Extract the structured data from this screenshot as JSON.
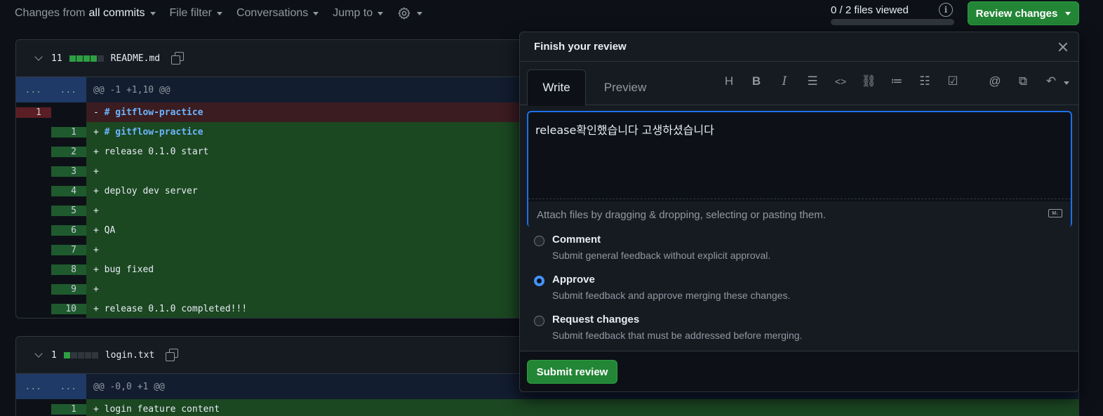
{
  "toolbar": {
    "changes_prefix": "Changes from",
    "changes_value": "all commits",
    "file_filter": "File filter",
    "conversations": "Conversations",
    "jump_to": "Jump to"
  },
  "progress": {
    "files_viewed": "0 / 2 files viewed",
    "fraction": 0
  },
  "review_button": "Review changes",
  "files": [
    {
      "count": "11",
      "name": "README.md",
      "hunk": "@@ -1 +1,10 @@",
      "dots": "...",
      "rows": [
        {
          "old": "1",
          "new": "",
          "sign": "-",
          "text": "# gitflow-practice"
        },
        {
          "old": "",
          "new": "1",
          "sign": "+",
          "text": "# gitflow-practice"
        },
        {
          "old": "",
          "new": "2",
          "sign": "+",
          "text": "release 0.1.0 start"
        },
        {
          "old": "",
          "new": "3",
          "sign": "+",
          "text": ""
        },
        {
          "old": "",
          "new": "4",
          "sign": "+",
          "text": "deploy dev server"
        },
        {
          "old": "",
          "new": "5",
          "sign": "+",
          "text": ""
        },
        {
          "old": "",
          "new": "6",
          "sign": "+",
          "text": "QA"
        },
        {
          "old": "",
          "new": "7",
          "sign": "+",
          "text": ""
        },
        {
          "old": "",
          "new": "8",
          "sign": "+",
          "text": "bug fixed"
        },
        {
          "old": "",
          "new": "9",
          "sign": "+",
          "text": ""
        },
        {
          "old": "",
          "new": "10",
          "sign": "+",
          "text": "release 0.1.0 completed!!!"
        }
      ]
    },
    {
      "count": "1",
      "name": "login.txt",
      "hunk": "@@ -0,0 +1 @@",
      "dots": "...",
      "rows": [
        {
          "old": "",
          "new": "1",
          "sign": "+",
          "text": "login feature content"
        }
      ]
    }
  ],
  "review": {
    "title": "Finish your review",
    "tab_write": "Write",
    "tab_preview": "Preview",
    "toolbar_icons": [
      "heading-icon",
      "bold-icon",
      "italic-icon",
      "quote-icon",
      "code-icon",
      "link-icon",
      "unordered-list-icon",
      "ordered-list-icon",
      "task-list-icon",
      "mention-icon",
      "reference-icon",
      "reply-icon"
    ],
    "comment_text": "release확인했습니다 고생하셨습니다",
    "attach_hint": "Attach files by dragging & dropping, selecting or pasting them.",
    "options": [
      {
        "title": "Comment",
        "desc": "Submit general feedback without explicit approval.",
        "selected": false
      },
      {
        "title": "Approve",
        "desc": "Submit feedback and approve merging these changes.",
        "selected": true
      },
      {
        "title": "Request changes",
        "desc": "Submit feedback that must be addressed before merging.",
        "selected": false
      }
    ],
    "submit": "Submit review"
  }
}
